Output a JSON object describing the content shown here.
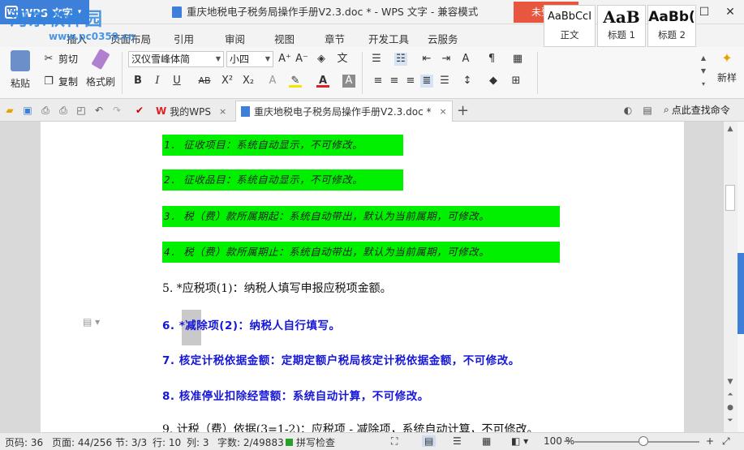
{
  "title_bar": {
    "app_name": "WPS 文字",
    "app_caret": "▾",
    "document_title": "重庆地税电子税务局操作手册V2.3.doc * - WPS 文字 - 兼容模式",
    "login_label": "未登录",
    "help_label": "?·",
    "window_controls": [
      "restore-icon",
      "minimize-icon",
      "maximize-icon",
      "close-icon"
    ]
  },
  "watermark": {
    "text": "河东软件园",
    "url": "www.pc0359.cn"
  },
  "menu": {
    "tabs": [
      "插入",
      "页面布局",
      "引用",
      "审阅",
      "视图",
      "章节",
      "开发工具",
      "云服务"
    ]
  },
  "ribbon": {
    "paste": "粘贴",
    "cut": "剪切",
    "copy": "复制",
    "format_painter": "格式刷",
    "font_name": "汉仪雪峰体简",
    "font_size": "小四",
    "bold": "B",
    "italic": "I",
    "underline": "U",
    "styles": [
      {
        "sample": "AaBbCcI",
        "label": "正文"
      },
      {
        "sample": "AaB",
        "label": "标题 1"
      },
      {
        "sample": "AaBb(",
        "label": "标题 2"
      }
    ],
    "new_style": "新样"
  },
  "tab_bar": {
    "tabs": [
      {
        "label": "我的WPS",
        "close": "×"
      },
      {
        "label": "重庆地税电子税务局操作手册V2.3.doc *",
        "close": "×"
      }
    ],
    "add_tab": "+",
    "search_label": "点此查找命令"
  },
  "document": {
    "highlighted_lines": [
      "1. 征收项目：系统自动显示，不可修改。",
      "2. 征收品目：系统自动显示，不可修改。",
      "3. 税（费）款所属期起：系统自动带出，默认为当前属期，可修改。",
      "4. 税（费）款所属期止：系统自动带出，默认为当前属期，可修改。"
    ],
    "para5": "5.   *应税项(1)：纳税人填写申报应税项金额。",
    "blue_lines": [
      "6. *减除项(2)：纳税人自行填写。",
      "7. 核定计税依据金额：定期定额户税局核定计税依据金额，不可修改。",
      "8. 核准停业扣除经营额：系统自动计算，不可修改。"
    ],
    "para9": "9.   计税（费）依据(3=1-2)：应税项 - 减除项，系统自动计算，不可修改。"
  },
  "status_bar": {
    "page_num": "页码: 36",
    "page_of": "页面: 44/256",
    "section": "节: 3/3",
    "row": "行: 10",
    "col": "列: 3",
    "word_count": "字数: 2/49883",
    "spell_check": "拼写检查",
    "zoom": "100 %",
    "zoom_level": 0.55
  },
  "colors": {
    "accent": "#3d7fd9",
    "login": "#e8563f",
    "highlight": "#00f000",
    "blue_text": "#1616d8"
  }
}
